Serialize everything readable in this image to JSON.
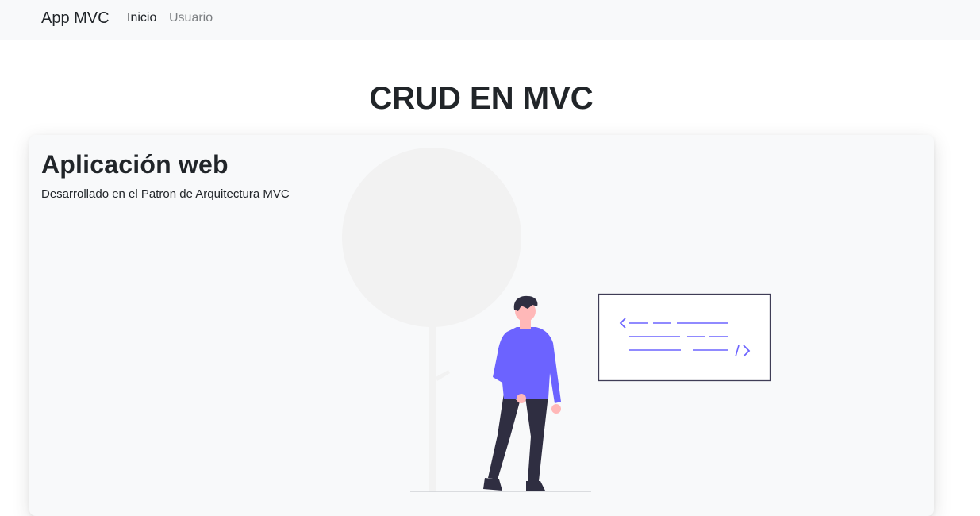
{
  "navbar": {
    "brand": "App MVC",
    "links": [
      {
        "label": "Inicio",
        "active": true
      },
      {
        "label": "Usuario",
        "active": false
      }
    ]
  },
  "page": {
    "title": "CRUD EN MVC"
  },
  "hero_card": {
    "title": "Aplicación web",
    "subtitle": "Desarrollado en el Patron de Arquitectura MVC"
  },
  "colors": {
    "navbar_bg": "#f8f9fa",
    "card_bg": "#f8f9fa",
    "accent": "#6c63ff",
    "text": "#212529",
    "muted_link": "#7c7f82",
    "tree": "#f2f2f2",
    "dark": "#2f2e41",
    "skin": "#ffb8b8"
  },
  "illustration": {
    "icon": "developer-illustration",
    "code_window_icon": "code-window-icon"
  }
}
